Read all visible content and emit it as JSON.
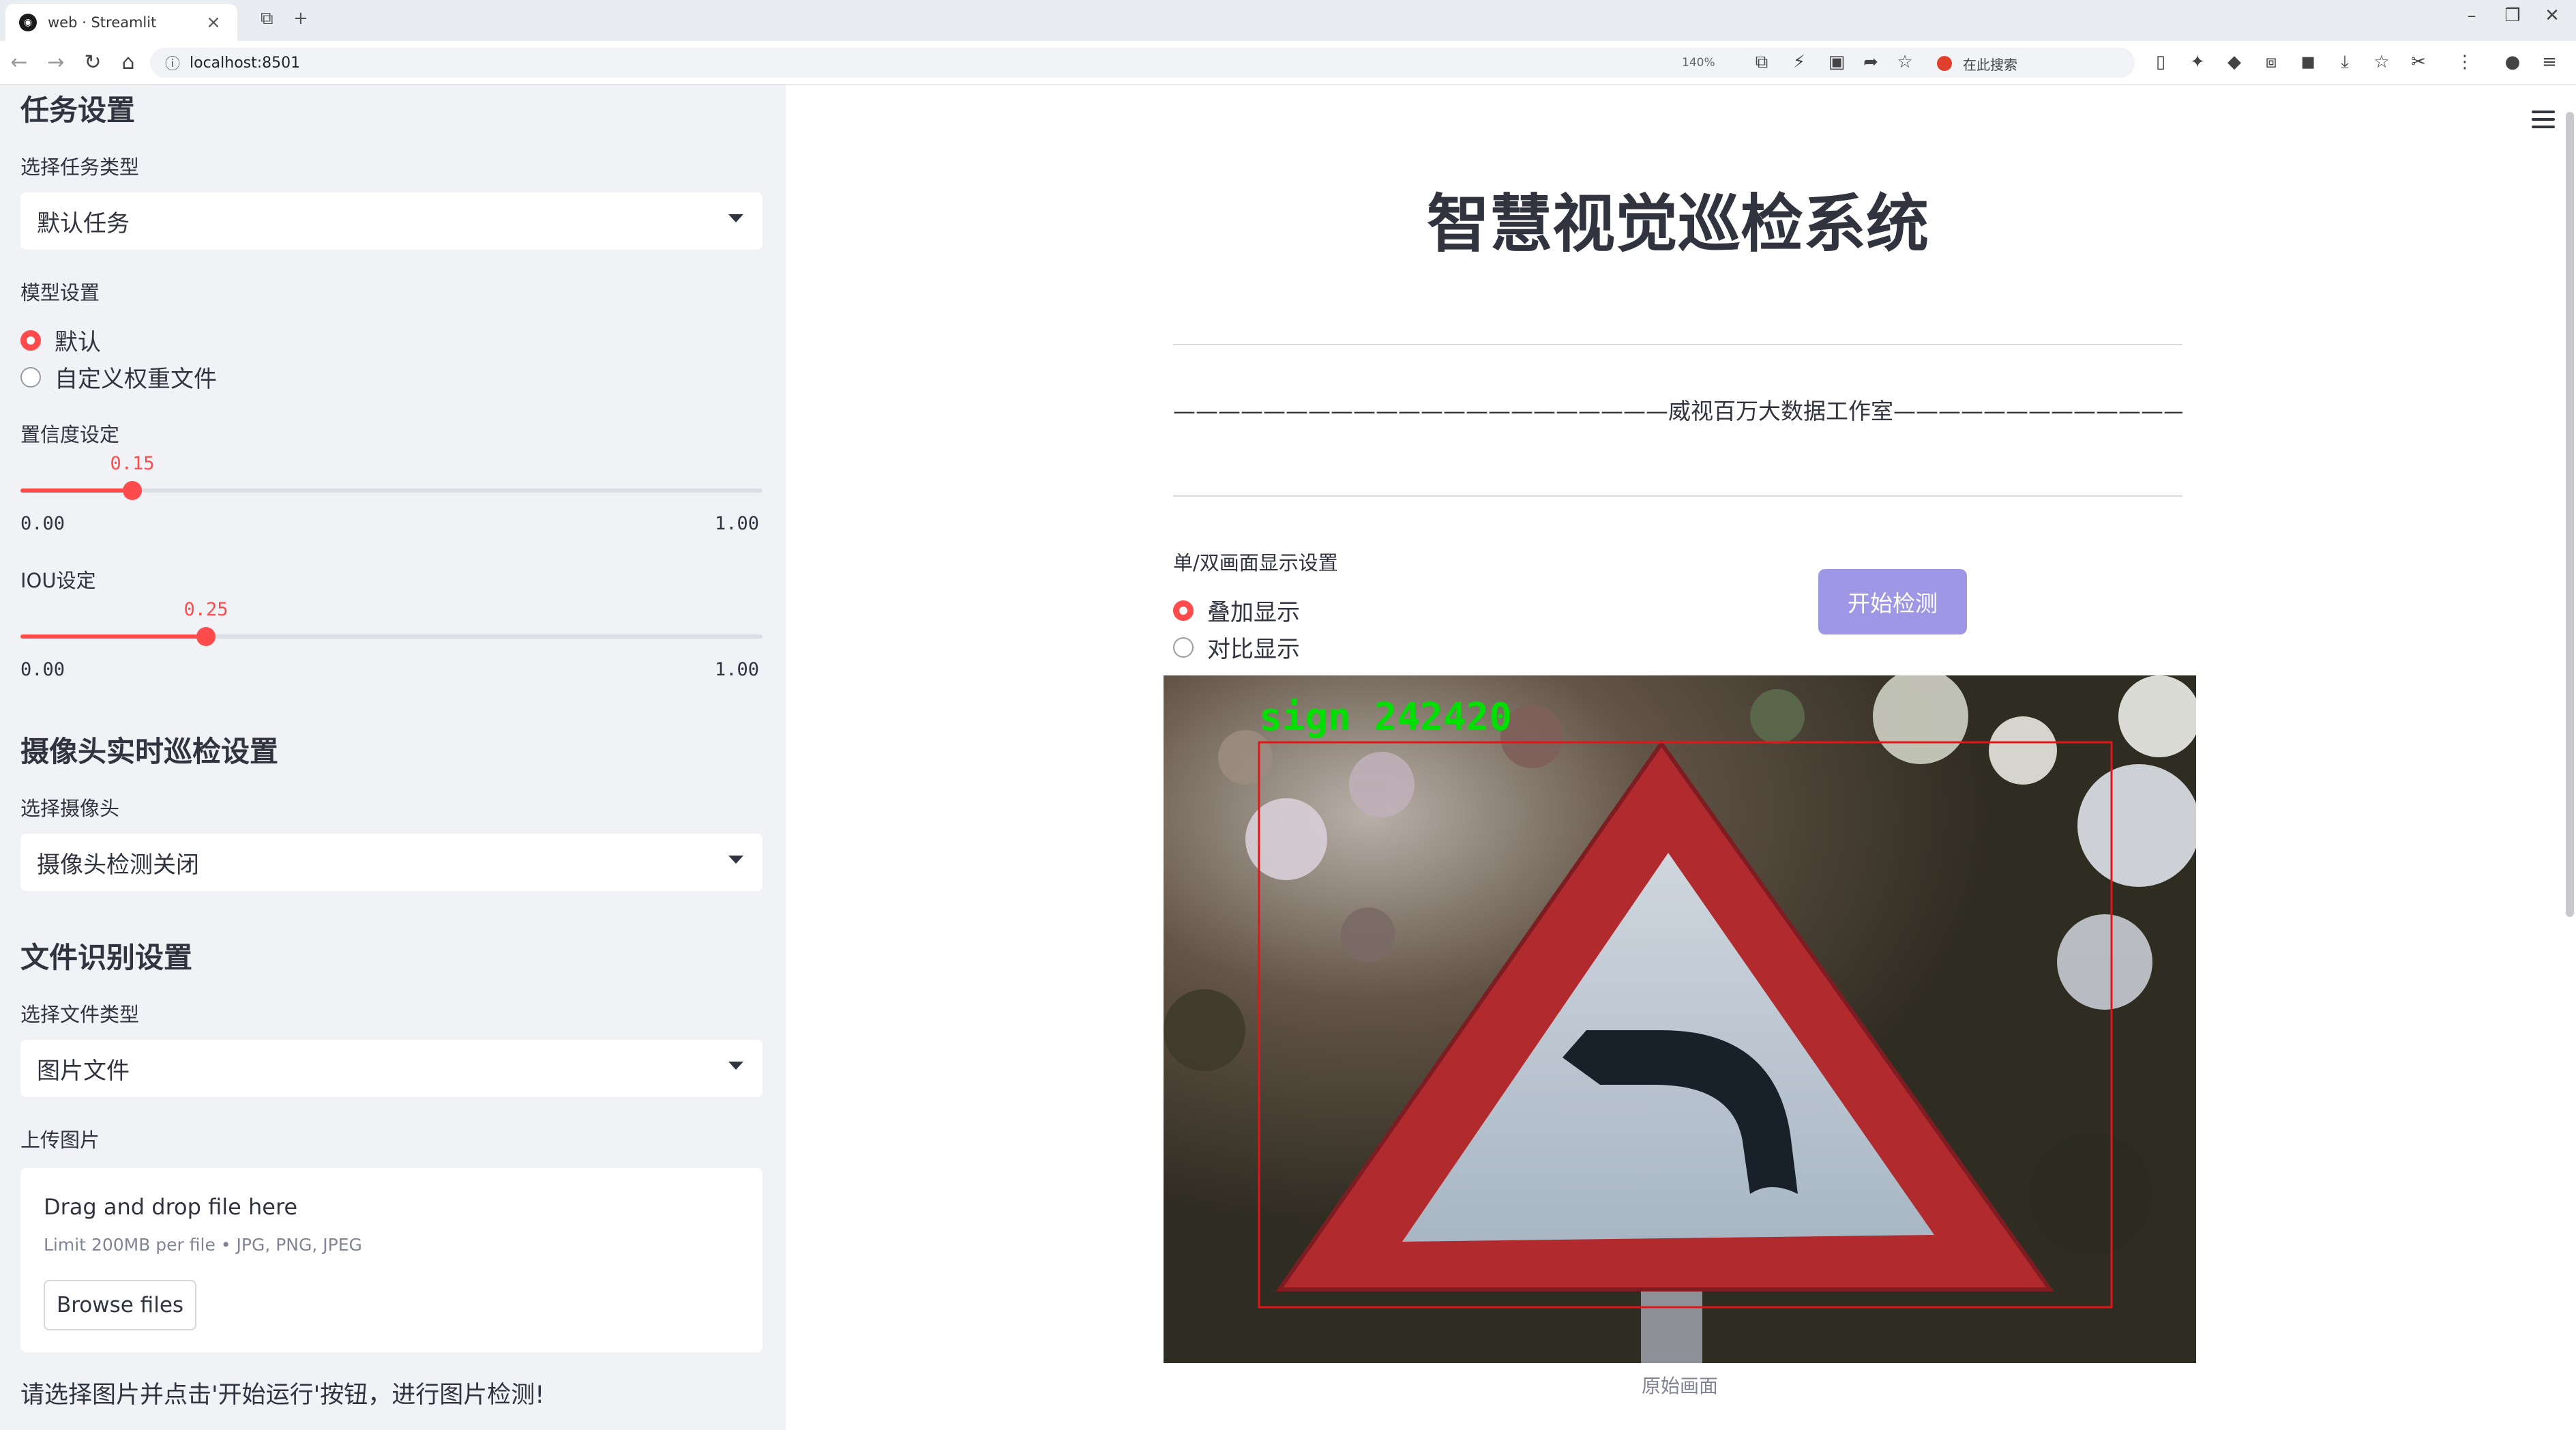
{
  "browser": {
    "tab_title": "web · Streamlit",
    "tab_close": "×",
    "new_tab": "+",
    "tab_grid": "⧉",
    "window_min": "–",
    "window_restore": "❐",
    "window_close": "✕",
    "url": "localhost:8501",
    "zoom": "140%",
    "search_label": "在此搜索",
    "nav_back": "←",
    "nav_forward": "→",
    "nav_reload": "↻",
    "nav_home": "⌂"
  },
  "sidebar": {
    "task_heading": "任务设置",
    "task_type_label": "选择任务类型",
    "task_type_value": "默认任务",
    "model_label": "模型设置",
    "model_options": [
      "默认",
      "自定义权重文件"
    ],
    "model_selected": 0,
    "conf_label": "置信度设定",
    "conf_value": "0.15",
    "conf_min": "0.00",
    "conf_max": "1.00",
    "iou_label": "IOU设定",
    "iou_value": "0.25",
    "iou_min": "0.00",
    "iou_max": "1.00",
    "camera_heading": "摄像头实时巡检设置",
    "camera_label": "选择摄像头",
    "camera_value": "摄像头检测关闭",
    "file_heading": "文件识别设置",
    "file_type_label": "选择文件类型",
    "file_type_value": "图片文件",
    "upload_label": "上传图片",
    "upload_title": "Drag and drop file here",
    "upload_limit": "Limit 200MB per file • JPG, PNG, JPEG",
    "browse_label": "Browse files",
    "hint": "请选择图片并点击'开始运行'按钮，进行图片检测!"
  },
  "main": {
    "title": "智慧视觉巡检系统",
    "subtitle": "——————————————————————威视百万大数据工作室——————————————————————",
    "display_label": "单/双画面显示设置",
    "display_options": [
      "叠加显示",
      "对比显示"
    ],
    "display_selected": 0,
    "start_button": "开始检测",
    "detection_label": "sign  242420",
    "caption": "原始画面"
  },
  "colors": {
    "accent": "#ff4b4b",
    "button": "#9d97e6",
    "detection_box": "#e0161b",
    "detection_text": "#00e000"
  }
}
